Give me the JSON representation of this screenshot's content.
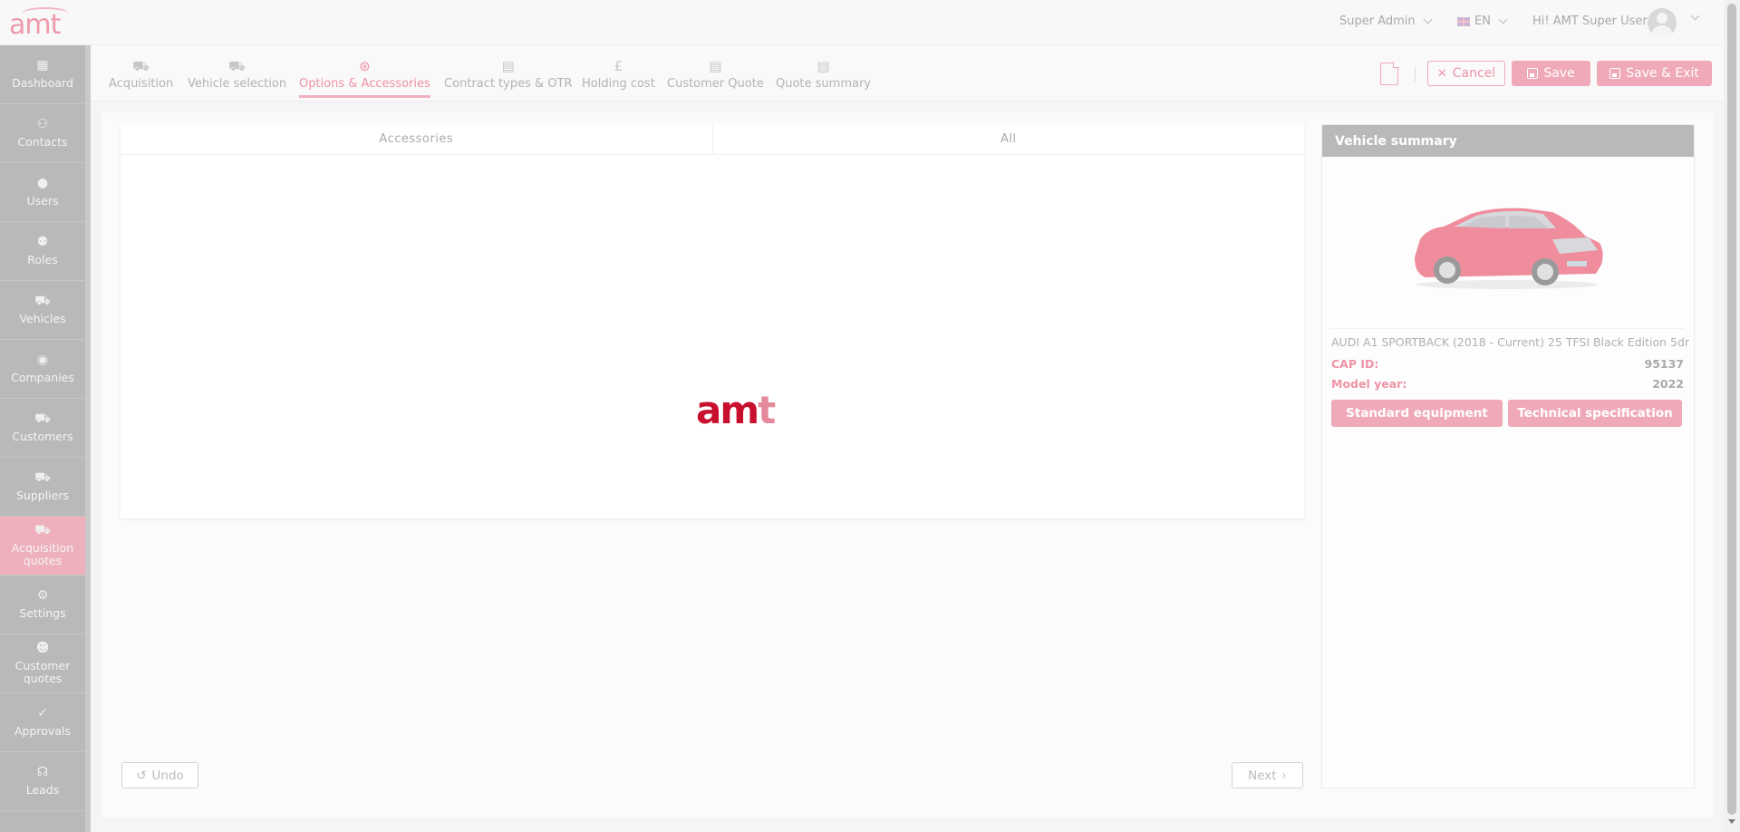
{
  "header": {
    "logo_text": "amt",
    "role": "Super Admin",
    "language": "EN",
    "greeting": "Hi! AMT Super User"
  },
  "sidebar": {
    "items": [
      {
        "label": "Dashboard",
        "icon": "dashboard-icon"
      },
      {
        "label": "Contacts",
        "icon": "contacts-icon"
      },
      {
        "label": "Users",
        "icon": "user-icon"
      },
      {
        "label": "Roles",
        "icon": "roles-icon"
      },
      {
        "label": "Vehicles",
        "icon": "car-icon"
      },
      {
        "label": "Companies",
        "icon": "companies-icon"
      },
      {
        "label": "Customers",
        "icon": "customers-icon"
      },
      {
        "label": "Suppliers",
        "icon": "suppliers-icon"
      },
      {
        "label": "Acquisition quotes",
        "icon": "acquisition-quotes-icon",
        "active": true
      },
      {
        "label": "Settings",
        "icon": "gear-icon"
      },
      {
        "label": "Customer quotes",
        "icon": "customer-quotes-icon"
      },
      {
        "label": "Approvals",
        "icon": "approvals-icon"
      },
      {
        "label": "Leads",
        "icon": "headset-icon"
      }
    ]
  },
  "steps": [
    {
      "label": "Acquisition",
      "icon": "acquisition-icon"
    },
    {
      "label": "Vehicle selection",
      "icon": "car-icon"
    },
    {
      "label": "Options & Accessories",
      "icon": "options-icon",
      "active": true
    },
    {
      "label": "Contract types & OTR",
      "icon": "calculator-icon"
    },
    {
      "label": "Holding cost",
      "icon": "pound-icon"
    },
    {
      "label": "Customer Quote",
      "icon": "quote-icon"
    },
    {
      "label": "Quote summary",
      "icon": "summary-doc-icon"
    }
  ],
  "actions": {
    "cancel": "Cancel",
    "save": "Save",
    "save_exit": "Save & Exit"
  },
  "options_panel": {
    "tabs": [
      "Accessories",
      "All"
    ],
    "loader_logo": "amt"
  },
  "footer": {
    "undo": "Undo",
    "next": "Next"
  },
  "vehicle_summary": {
    "title": "Vehicle summary",
    "vehicle_name": "AUDI A1 SPORTBACK (2018 - Current) 25 TFSI Black Edition 5dr",
    "cap_id_label": "CAP ID:",
    "cap_id": "95137",
    "model_year_label": "Model year:",
    "model_year": "2022",
    "btn_standard": "Standard equipment",
    "btn_technical": "Technical specification"
  },
  "colors": {
    "accent": "#f0a9b8",
    "accent_text": "#ee93a6",
    "sidebar": "#b9b9b9",
    "brand_red": "#c8102e"
  }
}
